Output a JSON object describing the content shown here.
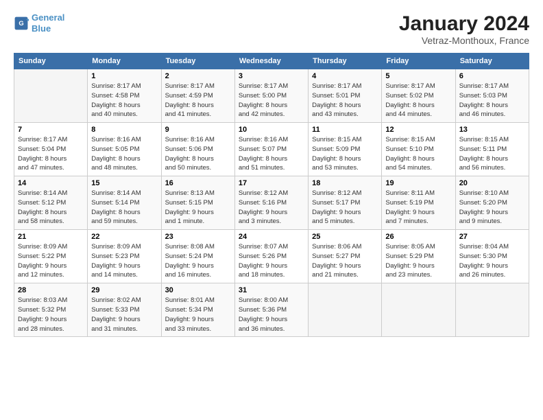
{
  "header": {
    "logo_line1": "General",
    "logo_line2": "Blue",
    "month_title": "January 2024",
    "subtitle": "Vetraz-Monthoux, France"
  },
  "days_of_week": [
    "Sunday",
    "Monday",
    "Tuesday",
    "Wednesday",
    "Thursday",
    "Friday",
    "Saturday"
  ],
  "weeks": [
    [
      {
        "day": "",
        "info": ""
      },
      {
        "day": "1",
        "info": "Sunrise: 8:17 AM\nSunset: 4:58 PM\nDaylight: 8 hours\nand 40 minutes."
      },
      {
        "day": "2",
        "info": "Sunrise: 8:17 AM\nSunset: 4:59 PM\nDaylight: 8 hours\nand 41 minutes."
      },
      {
        "day": "3",
        "info": "Sunrise: 8:17 AM\nSunset: 5:00 PM\nDaylight: 8 hours\nand 42 minutes."
      },
      {
        "day": "4",
        "info": "Sunrise: 8:17 AM\nSunset: 5:01 PM\nDaylight: 8 hours\nand 43 minutes."
      },
      {
        "day": "5",
        "info": "Sunrise: 8:17 AM\nSunset: 5:02 PM\nDaylight: 8 hours\nand 44 minutes."
      },
      {
        "day": "6",
        "info": "Sunrise: 8:17 AM\nSunset: 5:03 PM\nDaylight: 8 hours\nand 46 minutes."
      }
    ],
    [
      {
        "day": "7",
        "info": "Sunrise: 8:17 AM\nSunset: 5:04 PM\nDaylight: 8 hours\nand 47 minutes."
      },
      {
        "day": "8",
        "info": "Sunrise: 8:16 AM\nSunset: 5:05 PM\nDaylight: 8 hours\nand 48 minutes."
      },
      {
        "day": "9",
        "info": "Sunrise: 8:16 AM\nSunset: 5:06 PM\nDaylight: 8 hours\nand 50 minutes."
      },
      {
        "day": "10",
        "info": "Sunrise: 8:16 AM\nSunset: 5:07 PM\nDaylight: 8 hours\nand 51 minutes."
      },
      {
        "day": "11",
        "info": "Sunrise: 8:15 AM\nSunset: 5:09 PM\nDaylight: 8 hours\nand 53 minutes."
      },
      {
        "day": "12",
        "info": "Sunrise: 8:15 AM\nSunset: 5:10 PM\nDaylight: 8 hours\nand 54 minutes."
      },
      {
        "day": "13",
        "info": "Sunrise: 8:15 AM\nSunset: 5:11 PM\nDaylight: 8 hours\nand 56 minutes."
      }
    ],
    [
      {
        "day": "14",
        "info": "Sunrise: 8:14 AM\nSunset: 5:12 PM\nDaylight: 8 hours\nand 58 minutes."
      },
      {
        "day": "15",
        "info": "Sunrise: 8:14 AM\nSunset: 5:14 PM\nDaylight: 8 hours\nand 59 minutes."
      },
      {
        "day": "16",
        "info": "Sunrise: 8:13 AM\nSunset: 5:15 PM\nDaylight: 9 hours\nand 1 minute."
      },
      {
        "day": "17",
        "info": "Sunrise: 8:12 AM\nSunset: 5:16 PM\nDaylight: 9 hours\nand 3 minutes."
      },
      {
        "day": "18",
        "info": "Sunrise: 8:12 AM\nSunset: 5:17 PM\nDaylight: 9 hours\nand 5 minutes."
      },
      {
        "day": "19",
        "info": "Sunrise: 8:11 AM\nSunset: 5:19 PM\nDaylight: 9 hours\nand 7 minutes."
      },
      {
        "day": "20",
        "info": "Sunrise: 8:10 AM\nSunset: 5:20 PM\nDaylight: 9 hours\nand 9 minutes."
      }
    ],
    [
      {
        "day": "21",
        "info": "Sunrise: 8:09 AM\nSunset: 5:22 PM\nDaylight: 9 hours\nand 12 minutes."
      },
      {
        "day": "22",
        "info": "Sunrise: 8:09 AM\nSunset: 5:23 PM\nDaylight: 9 hours\nand 14 minutes."
      },
      {
        "day": "23",
        "info": "Sunrise: 8:08 AM\nSunset: 5:24 PM\nDaylight: 9 hours\nand 16 minutes."
      },
      {
        "day": "24",
        "info": "Sunrise: 8:07 AM\nSunset: 5:26 PM\nDaylight: 9 hours\nand 18 minutes."
      },
      {
        "day": "25",
        "info": "Sunrise: 8:06 AM\nSunset: 5:27 PM\nDaylight: 9 hours\nand 21 minutes."
      },
      {
        "day": "26",
        "info": "Sunrise: 8:05 AM\nSunset: 5:29 PM\nDaylight: 9 hours\nand 23 minutes."
      },
      {
        "day": "27",
        "info": "Sunrise: 8:04 AM\nSunset: 5:30 PM\nDaylight: 9 hours\nand 26 minutes."
      }
    ],
    [
      {
        "day": "28",
        "info": "Sunrise: 8:03 AM\nSunset: 5:32 PM\nDaylight: 9 hours\nand 28 minutes."
      },
      {
        "day": "29",
        "info": "Sunrise: 8:02 AM\nSunset: 5:33 PM\nDaylight: 9 hours\nand 31 minutes."
      },
      {
        "day": "30",
        "info": "Sunrise: 8:01 AM\nSunset: 5:34 PM\nDaylight: 9 hours\nand 33 minutes."
      },
      {
        "day": "31",
        "info": "Sunrise: 8:00 AM\nSunset: 5:36 PM\nDaylight: 9 hours\nand 36 minutes."
      },
      {
        "day": "",
        "info": ""
      },
      {
        "day": "",
        "info": ""
      },
      {
        "day": "",
        "info": ""
      }
    ]
  ]
}
